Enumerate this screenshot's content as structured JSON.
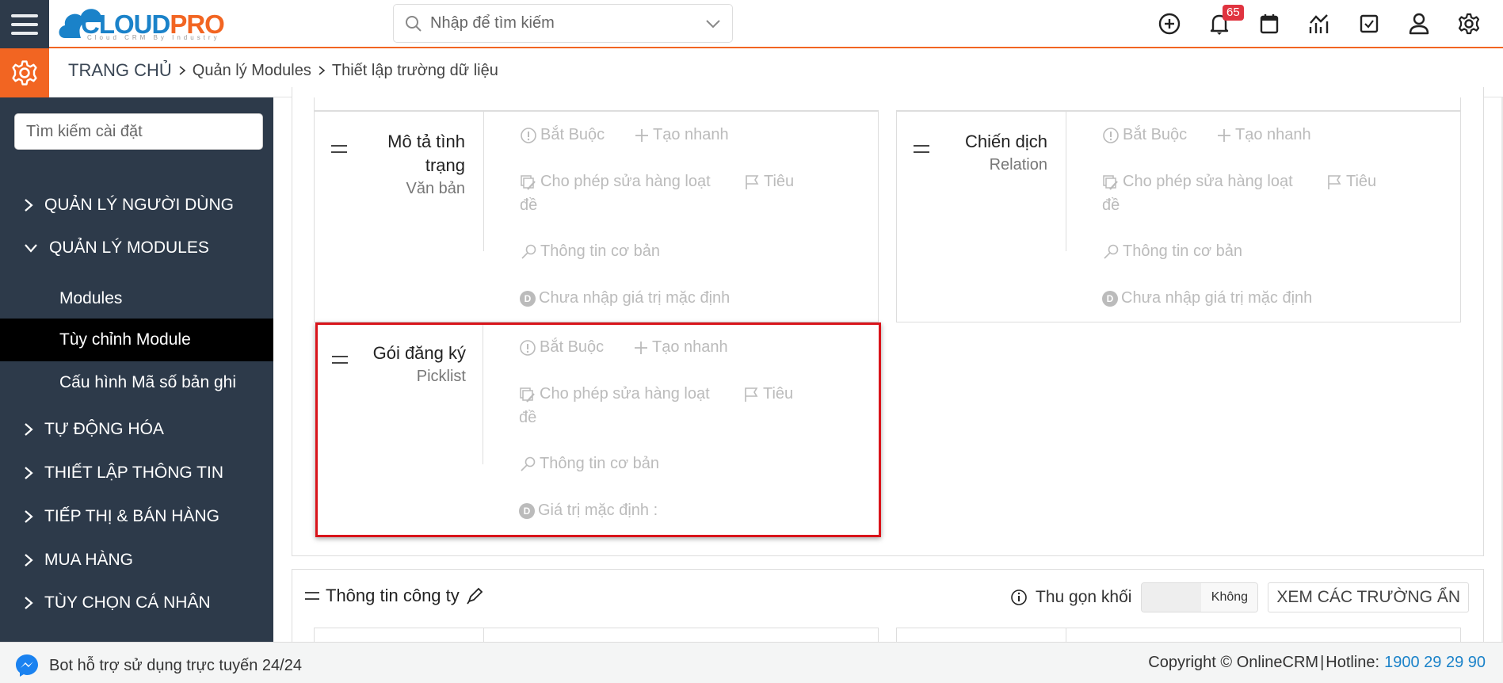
{
  "header": {
    "logo_main": "CLOUD",
    "logo_accent": "PRO",
    "logo_tagline": "Cloud CRM By Industry",
    "search_placeholder": "Nhập để tìm kiếm",
    "notification_count": "65",
    "icons": [
      "plus-circle-icon",
      "bell-icon",
      "calendar-icon",
      "report-chart-icon",
      "task-check-icon",
      "user-icon",
      "settings-gear-icon"
    ]
  },
  "breadcrumb": {
    "home": "TRANG CHỦ",
    "items": [
      "Quản lý Modules",
      "Thiết lập trường dữ liệu"
    ]
  },
  "sidebar": {
    "search_placeholder": "Tìm kiếm cài đặt",
    "items": [
      {
        "label": "QUẢN LÝ NGƯỜI DÙNG",
        "expanded": false
      },
      {
        "label": "QUẢN LÝ MODULES",
        "expanded": true
      },
      {
        "label": "Modules",
        "sub": true
      },
      {
        "label": "Tùy chỉnh Module",
        "sub": true,
        "active": true
      },
      {
        "label": "Cấu hình Mã số bản ghi",
        "sub": true
      },
      {
        "label": "TỰ ĐỘNG HÓA",
        "expanded": false
      },
      {
        "label": "THIẾT LẬP THÔNG TIN",
        "expanded": false
      },
      {
        "label": "TIẾP THỊ & BÁN HÀNG",
        "expanded": false
      },
      {
        "label": "MUA HÀNG",
        "expanded": false
      },
      {
        "label": "TÙY CHỌN CÁ NHÂN",
        "expanded": false
      }
    ]
  },
  "fields": [
    {
      "name": "Mô tả tình trạng",
      "type": "Văn bản",
      "options": {
        "required": "Bắt Buộc",
        "quick_create": "Tạo nhanh",
        "mass_edit": "Cho phép sửa hàng loạt",
        "header_a": "Tiêu",
        "header_b": "đề",
        "basic_info": "Thông tin cơ bản",
        "default_value": "Chưa nhập giá trị mặc định"
      }
    },
    {
      "name": "Chiến dịch",
      "type": "Relation",
      "options": {
        "required": "Bắt Buộc",
        "quick_create": "Tạo nhanh",
        "mass_edit": "Cho phép sửa hàng loạt",
        "header_a": "Tiêu",
        "header_b": "đề",
        "basic_info": "Thông tin cơ bản",
        "default_value": "Chưa nhập giá trị mặc định"
      }
    },
    {
      "name": "Gói đăng ký",
      "type": "Picklist",
      "highlighted": true,
      "options": {
        "required": "Bắt Buộc",
        "quick_create": "Tạo nhanh",
        "mass_edit": "Cho phép sửa hàng loạt",
        "header_a": "Tiêu",
        "header_b": "đề",
        "basic_info": "Thông tin cơ bản",
        "default_value": "Giá trị mặc định :"
      }
    }
  ],
  "company_section": {
    "title": "Thông tin công ty",
    "collapse_label": "Thu gọn khối",
    "toggle_value": "Không",
    "show_hidden_button": "XEM CÁC TRƯỜNG ẨN"
  },
  "footer": {
    "bot_text": "Bot hỗ trợ sử dụng trực tuyến 24/24",
    "copyright": "Copyright © OnlineCRM",
    "separator": "|",
    "hotline_label": "Hotline:",
    "hotline_number": "1900 29 29 90"
  },
  "colors": {
    "brand_orange": "#f26522",
    "brand_blue": "#1a82c9",
    "sidebar_bg": "#2d3a4a",
    "highlight_red": "#d9141b",
    "badge_red": "#e03440"
  }
}
